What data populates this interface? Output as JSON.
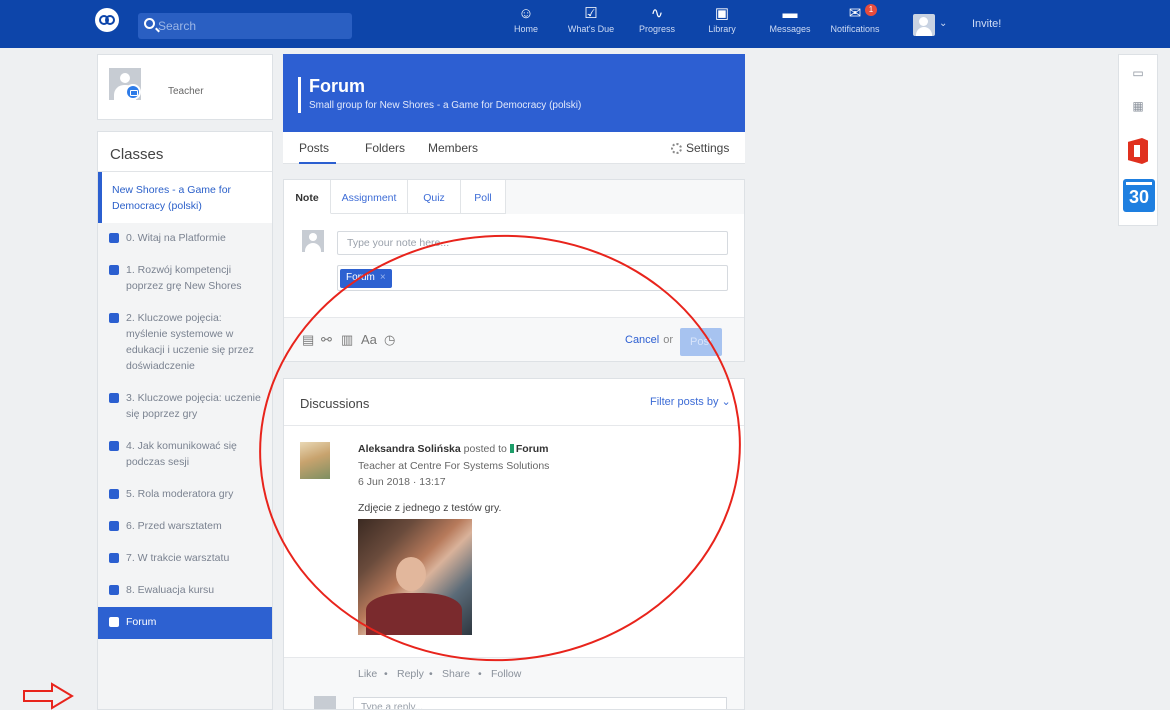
{
  "topnav": {
    "search_placeholder": "Search",
    "items": [
      {
        "label": "Home",
        "icon": "home-icon"
      },
      {
        "label": "What's Due",
        "icon": "calendar-check-icon"
      },
      {
        "label": "Progress",
        "icon": "pulse-icon"
      },
      {
        "label": "Library",
        "icon": "library-icon"
      },
      {
        "label": "Messages",
        "icon": "chat-icon"
      },
      {
        "label": "Notifications",
        "icon": "notification-icon"
      }
    ],
    "notification_count": "1",
    "invite_label": "Invite!"
  },
  "profile": {
    "name": "Teacher"
  },
  "classes": {
    "title": "Classes",
    "active_group": "New Shores - a Game for Democracy (polski)",
    "items": [
      "0. Witaj na Platformie",
      "1. Rozwój kompetencji poprzez grę New Shores",
      "2. Kluczowe pojęcia: myślenie systemowe w edukacji i uczenie się przez doświadczenie",
      "3. Kluczowe pojęcia: uczenie się poprzez gry",
      "4. Jak komunikować się podczas sesji",
      "5. Rola moderatora gry",
      "6. Przed warsztatem",
      "7. W trakcie warsztatu",
      "8. Ewaluacja kursu",
      "Forum"
    ]
  },
  "group": {
    "title": "Forum",
    "subtitle": "Small group for New Shores - a Game for Democracy (polski)",
    "tabs": [
      "Posts",
      "Folders",
      "Members"
    ],
    "settings_label": "Settings"
  },
  "composer": {
    "tabs": [
      "Note",
      "Assignment",
      "Quiz",
      "Poll"
    ],
    "note_placeholder": "Type your note here...",
    "recipient_chip": "Forum",
    "chip_remove": "×",
    "tool_format": "Aa",
    "cancel_label": "Cancel",
    "or_label": "or",
    "post_label": "Post"
  },
  "discussions": {
    "title": "Discussions",
    "filter_label": "Filter posts by",
    "post": {
      "author": "Aleksandra Solińska",
      "posted_to": "posted to",
      "group": "Forum",
      "role": "Teacher at Centre For Systems Solutions",
      "date": "6 Jun 2018 · 13:17",
      "text": "Zdjęcie z jednego z testów gry."
    },
    "actions": [
      "Like",
      "Reply",
      "Share",
      "Follow"
    ],
    "separator": "•",
    "reply_placeholder": "Type a reply..."
  },
  "colors": {
    "nav_bg": "#0d45aa",
    "accent": "#2d5fd2",
    "annotation": "#e8241c"
  }
}
